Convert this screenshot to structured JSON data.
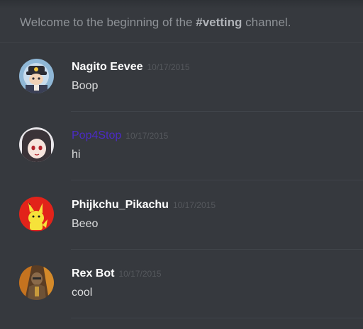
{
  "welcome": {
    "prefix": "Welcome to the beginning of the ",
    "channel": "#vetting",
    "suffix": " channel."
  },
  "messages": [
    {
      "author": "Nagito Eevee",
      "timestamp": "10/17/2015",
      "text": "Boop",
      "author_color": "#ffffff"
    },
    {
      "author": "Pop4Stop",
      "timestamp": "10/17/2015",
      "text": "hi",
      "author_color": "#4b2bc4"
    },
    {
      "author": "Phijkchu_Pikachu",
      "timestamp": "10/17/2015",
      "text": "Beeo",
      "author_color": "#ffffff"
    },
    {
      "author": "Rex Bot",
      "timestamp": "10/17/2015",
      "text": "cool",
      "author_color": "#ffffff"
    }
  ],
  "colors": {
    "background": "#36393e",
    "welcome_text": "#8e9297",
    "timestamp": "#55585d",
    "message_text": "#dcddde"
  }
}
